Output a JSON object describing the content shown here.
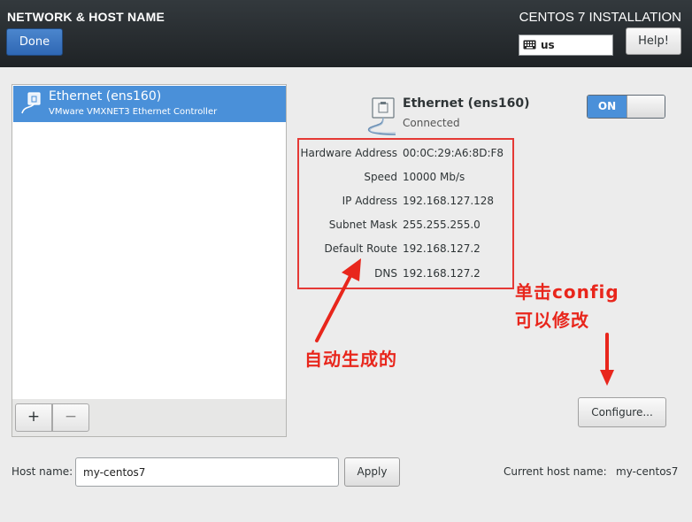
{
  "header": {
    "page_title": "NETWORK & HOST NAME",
    "done_label": "Done",
    "install_title": "CENTOS 7 INSTALLATION",
    "keyboard_layout": "us",
    "help_label": "Help!"
  },
  "device_list": {
    "items": [
      {
        "name": "Ethernet (ens160)",
        "description": "VMware VMXNET3 Ethernet Controller",
        "selected": true,
        "icon": "network-wired-icon"
      }
    ],
    "add_label": "+",
    "remove_label": "−"
  },
  "device_detail": {
    "name": "Ethernet (ens160)",
    "status": "Connected",
    "toggle_label": "ON",
    "toggle_on": true,
    "properties": [
      {
        "label": "Hardware Address",
        "value": "00:0C:29:A6:8D:F8"
      },
      {
        "label": "Speed",
        "value": "10000 Mb/s"
      },
      {
        "label": "IP Address",
        "value": "192.168.127.128"
      },
      {
        "label": "Subnet Mask",
        "value": "255.255.255.0"
      },
      {
        "label": "Default Route",
        "value": "192.168.127.2"
      },
      {
        "label": "DNS",
        "value": "192.168.127.2"
      }
    ],
    "configure_label": "Configure..."
  },
  "annotations": {
    "click_config_line1": "单击config",
    "click_config_line2": "可以修改",
    "auto_generated": "自动生成的",
    "color": "#e8261c"
  },
  "hostname": {
    "label": "Host name:",
    "value": "my-centos7",
    "apply_label": "Apply",
    "current_label": "Current host name:",
    "current_value": "my-centos7"
  },
  "colors": {
    "header_bg": "#2b3034",
    "accent_blue": "#4a90d9",
    "annotation_red": "#e53935"
  }
}
